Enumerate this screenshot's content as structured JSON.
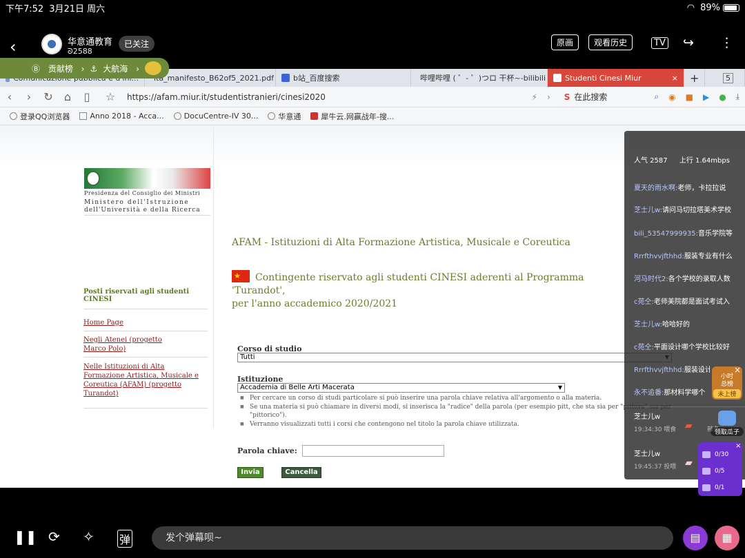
{
  "status_bar": {
    "time": "下午7:52",
    "date": "3月21日 周六",
    "battery": "89%",
    "battery_level": 0.89
  },
  "stream": {
    "streamer_name": "华意通教育",
    "fans": "2588",
    "follow_label": "已关注",
    "original_label": "原画",
    "history_label": "观看历史",
    "rank_label": "贡献榜",
    "fleet_label": "大航海"
  },
  "browser": {
    "tabs": [
      {
        "label": "Comunicazione pubblica e d'inf..."
      },
      {
        "label": "ita_manifesto_B62of5_2021.pdf"
      },
      {
        "label": "b站_百度搜索"
      },
      {
        "label": "哔哩哔哩 ( ゜- ゜)つロ 干杯~-bilibili"
      },
      {
        "label": "Studenti Cinesi Miur"
      }
    ],
    "tab_count": "5",
    "url": "https://afam.miur.it/studentistranieri/cinesi2020",
    "search_placeholder": "在此搜索",
    "bookmarks": [
      {
        "label": "登录QQ浏览器"
      },
      {
        "label": "Anno 2018 - Acca..."
      },
      {
        "label": "DocuCentre-IV 30..."
      },
      {
        "label": "华意通"
      },
      {
        "label": "犀牛云.网赢战年-搜..."
      }
    ]
  },
  "page": {
    "logo_line1": "Presidenza del Consiglio dei Ministri",
    "logo_line2": "Ministero dell'Istruzione",
    "logo_line3": "dell'Università e della Ricerca",
    "sidebar_heading": "Posti riservati agli studenti CINESI",
    "sidebar_links": [
      {
        "label": "Home Page"
      },
      {
        "label": "Negli Atenei (progetto Marco Polo)"
      },
      {
        "label": "Nelle Istituzioni di Alta Formazione Artistica, Musicale e Coreutica (AFAM) (progetto Turandot)"
      }
    ],
    "title": "AFAM - Istituzioni di Alta Formazione Artistica, Musicale e Coreutica",
    "subtitle_line1": "Contingente riservato agli studenti CINESI aderenti al Programma 'Turandot',",
    "subtitle_line2": "per l'anno accademico 2020/2021",
    "corso_label": "Corso di studio",
    "corso_value": "Tutti",
    "istituzione_label": "Istituzione",
    "istituzione_value": "Accademia di Belle Arti Macerata",
    "hints": [
      "Per cercare un corso di studi particolare si può inserire una parola chiave relativa all'argomento o alla materia.",
      "Se una materia si può chiamare in diversi modi, si inserisca la \"radice\" della parola (per esempio pitt, che sta sia per \"pittura\" sia per \"pittorico\").",
      "Verranno visualizzati tutti i corsi che contengono nel titolo la parola chiave utilizzata."
    ],
    "keyword_label": "Parola chiave:",
    "keyword_value": "",
    "submit_label": "Invia",
    "cancel_label": "Cancella"
  },
  "chat": {
    "popularity": "人气 2587",
    "upload": "上行 1.64mbps",
    "messages": [
      {
        "user": "夏天的雨水啊:",
        "text": "老师，卡拉拉说"
      },
      {
        "user": "芝士儿w:",
        "text": "请问马切拉塔美术学校"
      },
      {
        "user": "bili_53547999935:",
        "text": "音乐学院等"
      },
      {
        "user": "Rrrfthvvjfthhd:",
        "text": "服装专业有什么"
      },
      {
        "user": "河马时代2:",
        "text": "各个学校的录取人数"
      },
      {
        "user": "c苑仝:",
        "text": "老师美院都是面试考试入"
      },
      {
        "user": "芝士儿w:",
        "text": "哈哈好的"
      },
      {
        "user": "c苑仝:",
        "text": "平面设计哪个学校比较好"
      },
      {
        "user": "Rrrfthvvjfthhd:",
        "text": "服装设计专业个"
      },
      {
        "user": "永不追番:",
        "text": "那材料学哪个"
      }
    ],
    "gifts": [
      {
        "user": "芝士儿w",
        "time": "19:34:30 喂食",
        "extra": "辣条"
      },
      {
        "user": "芝士儿w",
        "time": "19:45:37 投喂",
        "extra": ""
      }
    ],
    "hourly_rank_line1": "小时",
    "hourly_rank_line2": "总榜",
    "hourly_rank_status": "未上榜",
    "melon_label": "领取瓜子",
    "tasks": [
      {
        "progress": "0/30"
      },
      {
        "progress": "0/5"
      },
      {
        "progress": "0/1"
      }
    ]
  },
  "bottom": {
    "danmaku_placeholder": "发个弹幕呗~"
  }
}
